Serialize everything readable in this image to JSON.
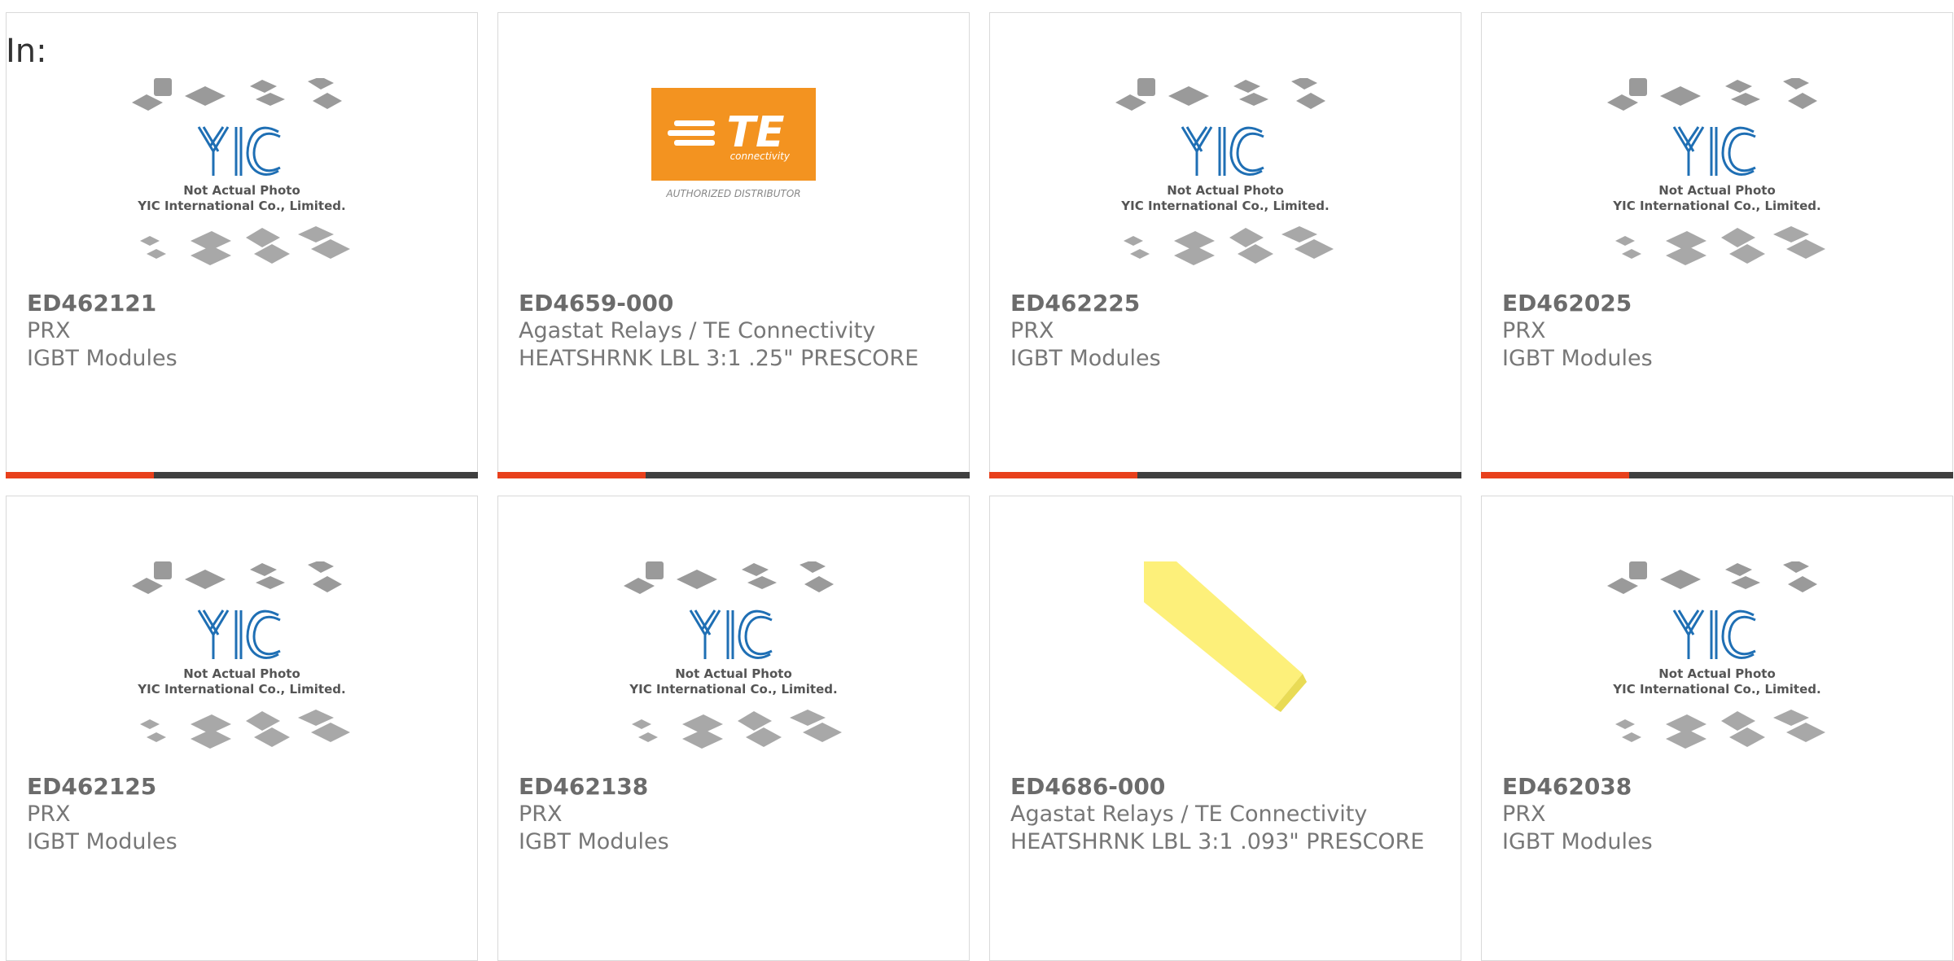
{
  "header": {
    "in_label": "In:"
  },
  "placeholder": {
    "line1": "Not Actual Photo",
    "line2": "YIC International Co., Limited."
  },
  "te_logo": {
    "brand": "TE",
    "sub": "connectivity",
    "caption": "AUTHORIZED DISTRIBUTOR"
  },
  "colors": {
    "accent": "#e8401c",
    "bar": "#3f3f3f",
    "te_orange": "#f39320",
    "yic_blue": "#1f6fb4"
  },
  "products": [
    {
      "part": "ED462121",
      "mfr": "PRX",
      "desc": "IGBT Modules",
      "image": "yic-placeholder"
    },
    {
      "part": "ED4659-000",
      "mfr": "Agastat Relays / TE Connectivity",
      "desc": "HEATSHRNK LBL 3:1 .25\" PRESCORE",
      "image": "te-logo"
    },
    {
      "part": "ED462225",
      "mfr": "PRX",
      "desc": "IGBT Modules",
      "image": "yic-placeholder"
    },
    {
      "part": "ED462025",
      "mfr": "PRX",
      "desc": "IGBT Modules",
      "image": "yic-placeholder"
    },
    {
      "part": "ED462125",
      "mfr": "PRX",
      "desc": "IGBT Modules",
      "image": "yic-placeholder"
    },
    {
      "part": "ED462138",
      "mfr": "PRX",
      "desc": "IGBT Modules",
      "image": "yic-placeholder"
    },
    {
      "part": "ED4686-000",
      "mfr": "Agastat Relays / TE Connectivity",
      "desc": "HEATSHRNK LBL 3:1 .093\" PRESCORE",
      "image": "yellow-tube"
    },
    {
      "part": "ED462038",
      "mfr": "PRX",
      "desc": "IGBT Modules",
      "image": "yic-placeholder"
    }
  ]
}
